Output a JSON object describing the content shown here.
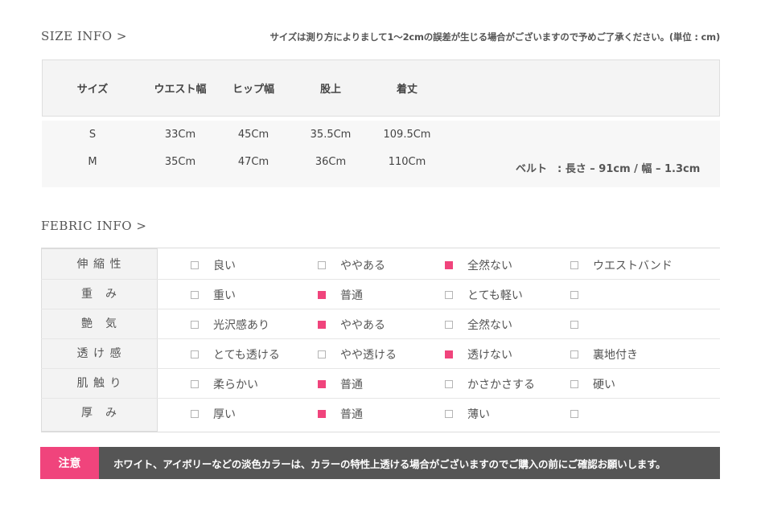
{
  "size_section": {
    "title": "SIZE INFO >",
    "note": "サイズは測り方によりまして1〜2cmの誤差が生じる場合がございますので予めご了承ください。(単位 : cm)",
    "headers": [
      "サイズ",
      "ウエスト幅",
      "ヒップ幅",
      "股上",
      "着丈"
    ],
    "rows": [
      [
        "S",
        "33Cm",
        "45Cm",
        "35.5Cm",
        "109.5Cm"
      ],
      [
        "M",
        "35Cm",
        "47Cm",
        "36Cm",
        "110Cm"
      ]
    ],
    "belt": "ベルト　: 長さ – 91cm / 幅 – 1.3cm"
  },
  "fabric_section": {
    "title": "FEBRIC INFO >",
    "rows": [
      {
        "label": "伸 縮 性",
        "options": [
          {
            "text": "良い",
            "checked": false
          },
          {
            "text": "ややある",
            "checked": false
          },
          {
            "text": "全然ない",
            "checked": true
          },
          {
            "text": "ウエストバンド",
            "checked": false
          }
        ]
      },
      {
        "label": "重　み",
        "options": [
          {
            "text": "重い",
            "checked": false
          },
          {
            "text": "普通",
            "checked": true
          },
          {
            "text": "とても軽い",
            "checked": false
          },
          {
            "text": "",
            "checked": false
          }
        ]
      },
      {
        "label": "艶　気",
        "options": [
          {
            "text": "光沢感あり",
            "checked": false
          },
          {
            "text": "ややある",
            "checked": true
          },
          {
            "text": "全然ない",
            "checked": false
          },
          {
            "text": "",
            "checked": false
          }
        ]
      },
      {
        "label": "透 け 感",
        "options": [
          {
            "text": "とても透ける",
            "checked": false
          },
          {
            "text": "やや透ける",
            "checked": false
          },
          {
            "text": "透けない",
            "checked": true
          },
          {
            "text": "裏地付き",
            "checked": false
          }
        ]
      },
      {
        "label": "肌 触 り",
        "options": [
          {
            "text": "柔らかい",
            "checked": false
          },
          {
            "text": "普通",
            "checked": true
          },
          {
            "text": "かさかさする",
            "checked": false
          },
          {
            "text": "硬い",
            "checked": false
          }
        ]
      },
      {
        "label": "厚　み",
        "options": [
          {
            "text": "厚い",
            "checked": false
          },
          {
            "text": "普通",
            "checked": true
          },
          {
            "text": "薄い",
            "checked": false
          },
          {
            "text": "",
            "checked": false
          }
        ]
      }
    ]
  },
  "notice": {
    "tag": "注意",
    "text": "ホワイト、アイボリーなどの淡色カラーは、カラーの特性上透ける場合がございますのでご購入の前にご確認お願いします。"
  },
  "colors": {
    "accent_pink": "#f0447c",
    "notice_bg": "#555555"
  }
}
